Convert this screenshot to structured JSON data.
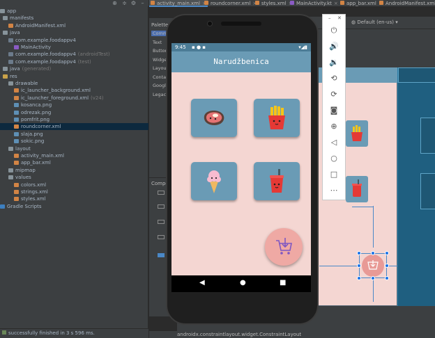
{
  "project": {
    "items": [
      {
        "label": "app",
        "icon": "folder"
      },
      {
        "label": "manifests",
        "icon": "folder"
      },
      {
        "label": "AndroidManifest.xml",
        "icon": "xml"
      },
      {
        "label": "java",
        "icon": "folder"
      },
      {
        "label": "com.example.foodappv4",
        "icon": "pkg"
      },
      {
        "label": "MainActivity",
        "icon": "kt"
      },
      {
        "label": "com.example.foodappv4",
        "icon": "pkg",
        "suffix": "(androidTest)"
      },
      {
        "label": "com.example.foodappv4",
        "icon": "pkg",
        "suffix": "(test)"
      },
      {
        "label": "java",
        "icon": "folder",
        "suffix": "(generated)"
      },
      {
        "label": "res",
        "icon": "res"
      },
      {
        "label": "drawable",
        "icon": "folder"
      },
      {
        "label": "ic_launcher_background.xml",
        "icon": "xml"
      },
      {
        "label": "ic_launcher_foreground.xml",
        "icon": "xml",
        "suffix": "(v24)"
      },
      {
        "label": "kosanca.png",
        "icon": "png"
      },
      {
        "label": "odrezak.png",
        "icon": "png"
      },
      {
        "label": "pomfrit.png",
        "icon": "png"
      },
      {
        "label": "roundcorner.xml",
        "icon": "xml"
      },
      {
        "label": "slaja.png",
        "icon": "png"
      },
      {
        "label": "sokic.png",
        "icon": "png"
      },
      {
        "label": "layout",
        "icon": "folder"
      },
      {
        "label": "activity_main.xml",
        "icon": "xml"
      },
      {
        "label": "app_bar.xml",
        "icon": "xml"
      },
      {
        "label": "mipmap",
        "icon": "folder"
      },
      {
        "label": "values",
        "icon": "folder"
      },
      {
        "label": "colors.xml",
        "icon": "xml"
      },
      {
        "label": "strings.xml",
        "icon": "xml"
      },
      {
        "label": "styles.xml",
        "icon": "xml"
      },
      {
        "label": "Gradle Scripts",
        "icon": "gradle"
      }
    ],
    "status": "successfully finished in 3 s 596 ms."
  },
  "tabs": [
    {
      "label": "activity_main.xml",
      "icon": "xml"
    },
    {
      "label": "roundcorner.xml",
      "icon": "xml"
    },
    {
      "label": "styles.xml",
      "icon": "xml"
    },
    {
      "label": "MainActivity.kt",
      "icon": "kt"
    },
    {
      "label": "app_bar.xml",
      "icon": "xml"
    },
    {
      "label": "AndroidManifest.xml",
      "icon": "xml"
    }
  ],
  "palette": {
    "title": "Palette",
    "items": [
      "Commo",
      "Text",
      "Button",
      "Widget",
      "Layouts",
      "Contai",
      "Google",
      "Legacy"
    ]
  },
  "component_tree": {
    "title": "Compon"
  },
  "designbar": {
    "locale": "Default (en-us)"
  },
  "bottom": {
    "class_name": "androidx.constraintlayout.widget.ConstraintLayout"
  },
  "app": {
    "status_time": "9:45",
    "title": "Narudžbenica",
    "foods": [
      {
        "name": "steak",
        "icon": "steak-icon"
      },
      {
        "name": "fries",
        "icon": "fries-icon"
      },
      {
        "name": "ice cream",
        "icon": "ice-cream-icon"
      },
      {
        "name": "soda",
        "icon": "soda-icon"
      }
    ]
  },
  "colors": {
    "app_bar": "#6a9bb5",
    "background": "#f4d6d2",
    "fab": "#efa9a4",
    "ide_dark": "#2b2b2b"
  }
}
